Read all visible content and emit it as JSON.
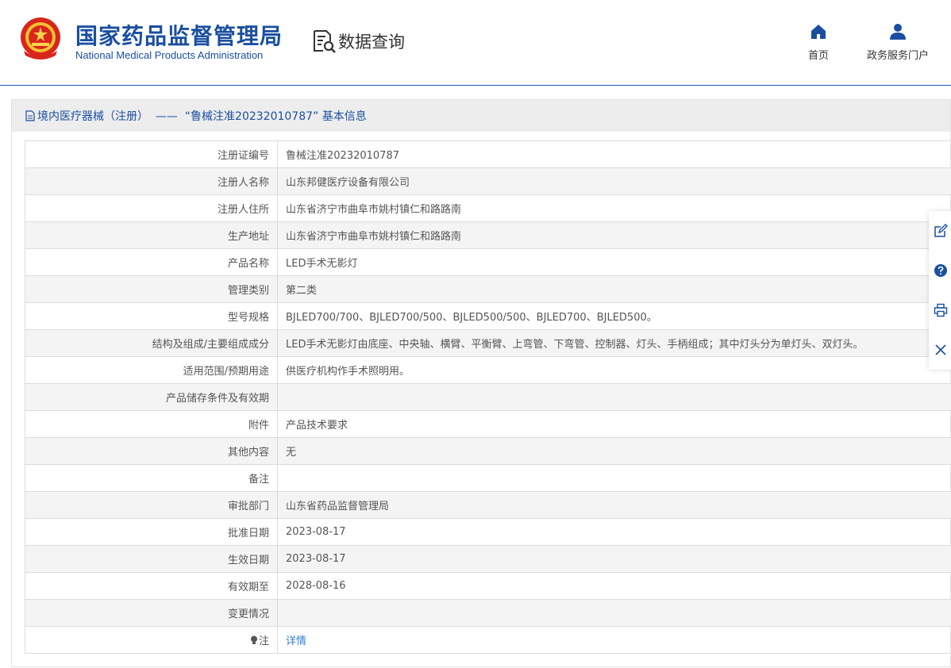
{
  "header": {
    "org_name_cn": "国家药品监督管理局",
    "org_name_en": "National Medical Products Administration",
    "query_label": "数据查询",
    "nav": [
      {
        "label": "首页",
        "icon": "home-icon"
      },
      {
        "label": "政务服务门户",
        "icon": "user-icon"
      }
    ]
  },
  "panel": {
    "title": "境内医疗器械（注册）  ——  “鲁械注准20232010787” 基本信息"
  },
  "records": [
    {
      "label": "注册证编号",
      "value": "鲁械注准20232010787"
    },
    {
      "label": "注册人名称",
      "value": "山东邦健医疗设备有限公司"
    },
    {
      "label": "注册人住所",
      "value": "山东省济宁市曲阜市姚村镇仁和路路南"
    },
    {
      "label": "生产地址",
      "value": "山东省济宁市曲阜市姚村镇仁和路路南"
    },
    {
      "label": "产品名称",
      "value": "LED手术无影灯"
    },
    {
      "label": "管理类别",
      "value": "第二类"
    },
    {
      "label": "型号规格",
      "value": "BJLED700/700、BJLED700/500、BJLED500/500、BJLED700、BJLED500。"
    },
    {
      "label": "结构及组成/主要组成成分",
      "value": "LED手术无影灯由底座、中央轴、横臂、平衡臂、上弯管、下弯管、控制器、灯头、手柄组成；其中灯头分为单灯头、双灯头。"
    },
    {
      "label": "适用范围/预期用途",
      "value": "供医疗机构作手术照明用。"
    },
    {
      "label": "产品储存条件及有效期",
      "value": ""
    },
    {
      "label": "附件",
      "value": "产品技术要求"
    },
    {
      "label": "其他内容",
      "value": "无"
    },
    {
      "label": "备注",
      "value": ""
    },
    {
      "label": "审批部门",
      "value": "山东省药品监督管理局"
    },
    {
      "label": "批准日期",
      "value": "2023-08-17"
    },
    {
      "label": "生效日期",
      "value": "2023-08-17"
    },
    {
      "label": "有效期至",
      "value": "2028-08-16"
    },
    {
      "label": "变更情况",
      "value": ""
    }
  ],
  "note": {
    "label": "注",
    "link": "详情",
    "icon": "lightbulb-icon"
  },
  "toolbar": [
    "edit-icon",
    "help-icon",
    "print-icon",
    "close-icon"
  ],
  "colors": {
    "brand": "#1a4fa0",
    "link": "#2f7fd6",
    "stripe": "#f4f4f4"
  }
}
